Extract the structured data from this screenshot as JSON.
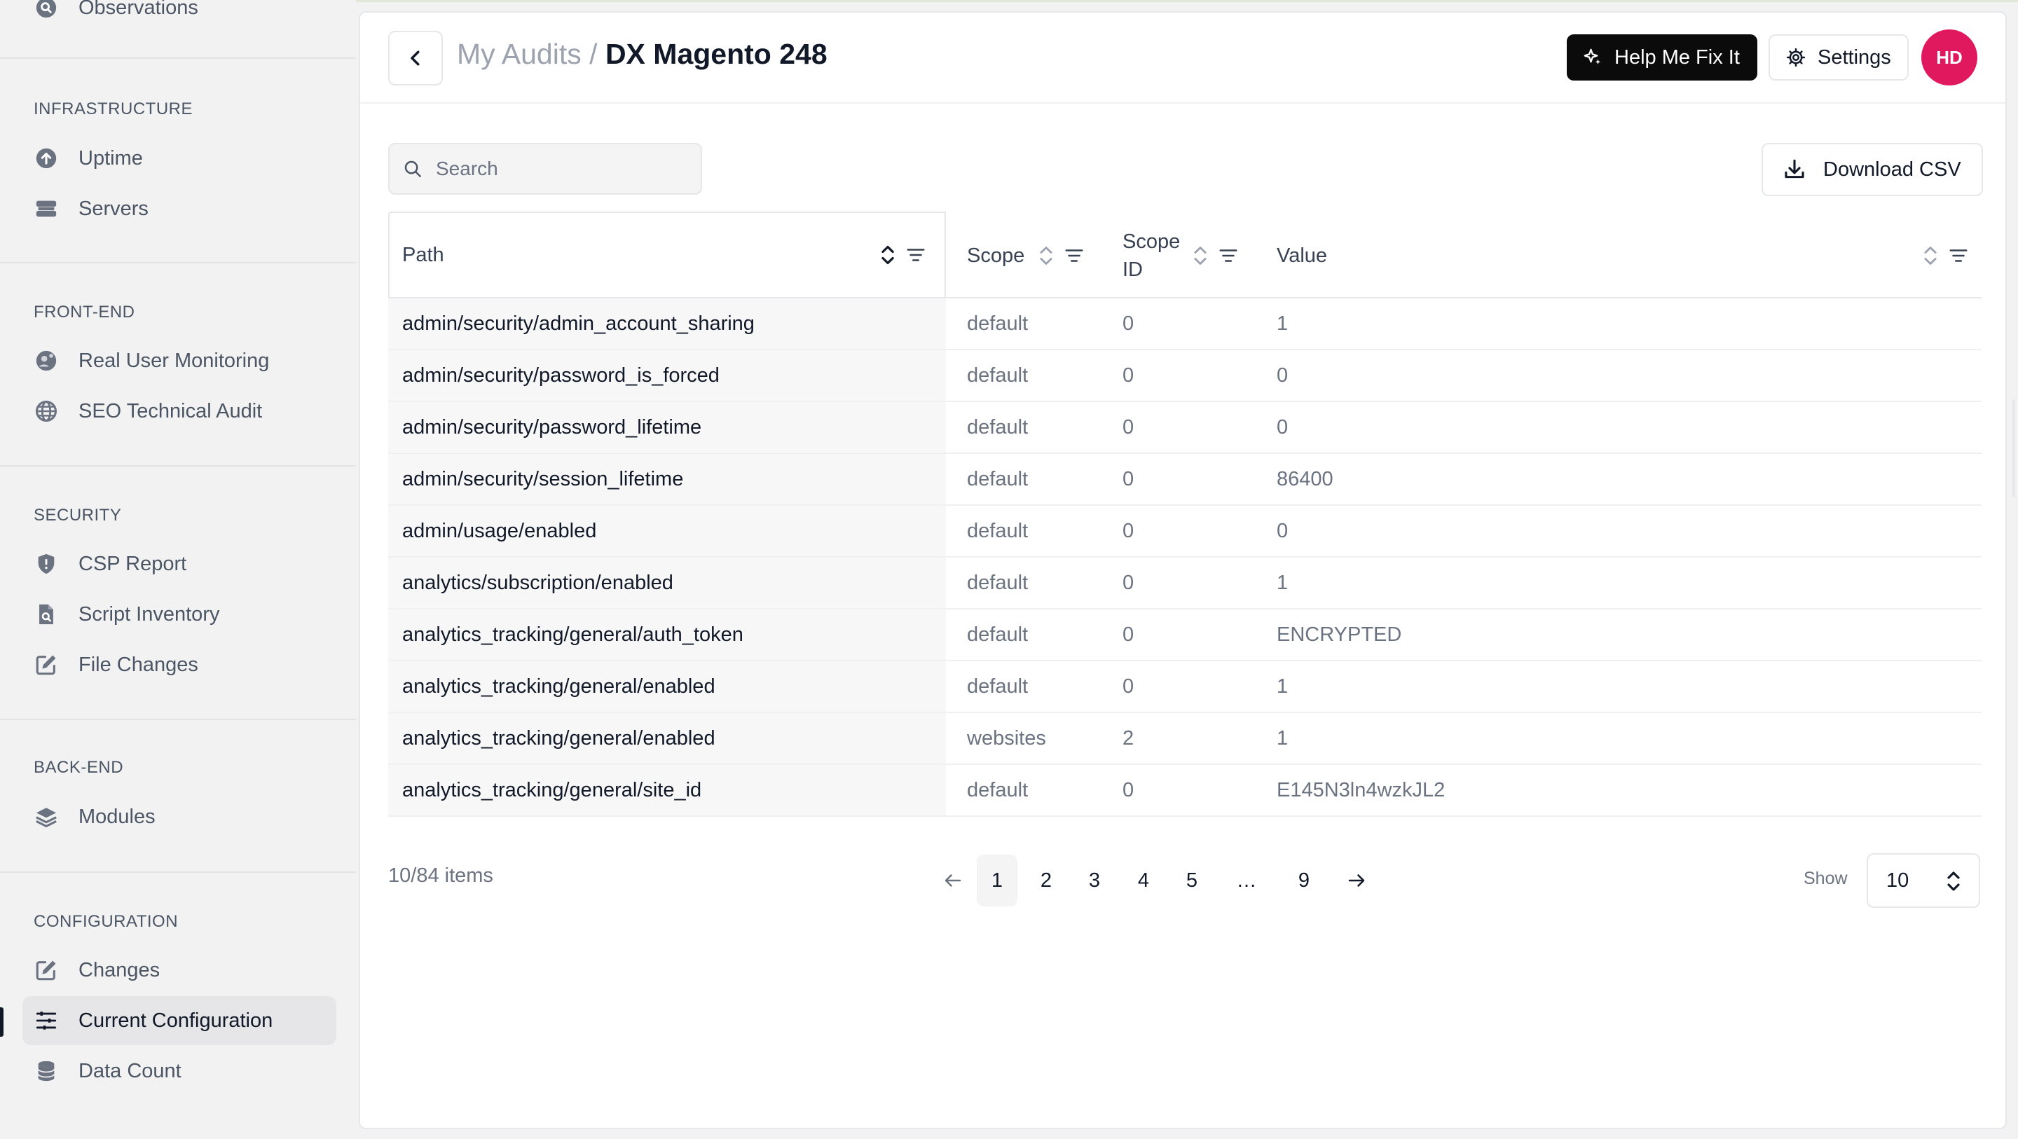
{
  "sidebar": {
    "first_item": {
      "label": "Observations",
      "icon": "magnifier-circle-icon"
    },
    "sections": [
      {
        "heading": "INFRASTRUCTURE",
        "items": [
          {
            "label": "Uptime",
            "icon": "arrow-up-circle-icon"
          },
          {
            "label": "Servers",
            "icon": "server-stack-icon"
          }
        ]
      },
      {
        "heading": "FRONT-END",
        "items": [
          {
            "label": "Real User Monitoring",
            "icon": "globe-user-icon"
          },
          {
            "label": "SEO Technical Audit",
            "icon": "globe-icon"
          }
        ]
      },
      {
        "heading": "SECURITY",
        "items": [
          {
            "label": "CSP Report",
            "icon": "shield-alert-icon"
          },
          {
            "label": "Script Inventory",
            "icon": "file-search-icon"
          },
          {
            "label": "File Changes",
            "icon": "pencil-square-icon"
          }
        ]
      },
      {
        "heading": "BACK-END",
        "items": [
          {
            "label": "Modules",
            "icon": "layers-icon"
          }
        ]
      },
      {
        "heading": "CONFIGURATION",
        "items": [
          {
            "label": "Changes",
            "icon": "pencil-square-icon"
          },
          {
            "label": "Current Configuration",
            "icon": "sliders-icon",
            "active": true
          },
          {
            "label": "Data Count",
            "icon": "database-icon"
          }
        ]
      }
    ]
  },
  "header": {
    "breadcrumb_parent": "My Audits",
    "breadcrumb_separator": "/",
    "title": "DX Magento 248",
    "help_button": "Help Me Fix It",
    "settings_button": "Settings",
    "avatar_initials": "HD",
    "avatar_color": "#e0185e"
  },
  "toolbar": {
    "search_placeholder": "Search",
    "download_button": "Download CSV"
  },
  "table": {
    "columns": {
      "path": "Path",
      "scope": "Scope",
      "scope_id_line1": "Scope",
      "scope_id_line2": "ID",
      "value": "Value"
    },
    "rows": [
      {
        "path": "admin/security/admin_account_sharing",
        "scope": "default",
        "scope_id": "0",
        "value": "1"
      },
      {
        "path": "admin/security/password_is_forced",
        "scope": "default",
        "scope_id": "0",
        "value": "0"
      },
      {
        "path": "admin/security/password_lifetime",
        "scope": "default",
        "scope_id": "0",
        "value": "0"
      },
      {
        "path": "admin/security/session_lifetime",
        "scope": "default",
        "scope_id": "0",
        "value": "86400"
      },
      {
        "path": "admin/usage/enabled",
        "scope": "default",
        "scope_id": "0",
        "value": "0"
      },
      {
        "path": "analytics/subscription/enabled",
        "scope": "default",
        "scope_id": "0",
        "value": "1"
      },
      {
        "path": "analytics_tracking/general/auth_token",
        "scope": "default",
        "scope_id": "0",
        "value": "ENCRYPTED"
      },
      {
        "path": "analytics_tracking/general/enabled",
        "scope": "default",
        "scope_id": "0",
        "value": "1"
      },
      {
        "path": "analytics_tracking/general/enabled",
        "scope": "websites",
        "scope_id": "2",
        "value": "1"
      },
      {
        "path": "analytics_tracking/general/site_id",
        "scope": "default",
        "scope_id": "0",
        "value": "E145N3ln4wzkJL2"
      }
    ]
  },
  "pagination": {
    "items_count": "10/84 items",
    "pages": [
      "1",
      "2",
      "3",
      "4",
      "5",
      "…",
      "9"
    ],
    "current_page": "1",
    "show_label": "Show",
    "page_size": "10"
  }
}
